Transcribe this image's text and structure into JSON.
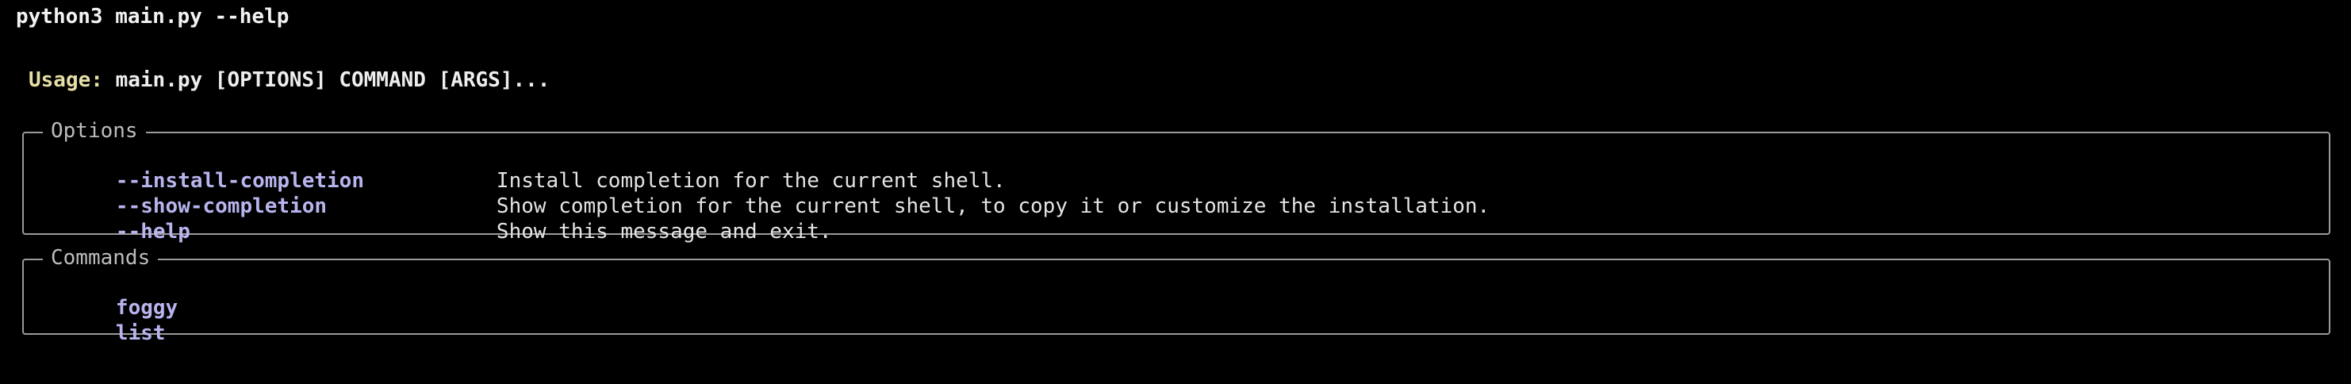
{
  "terminal": {
    "command_line": "python3 main.py --help"
  },
  "usage": {
    "label": "Usage:",
    "text": "main.py [OPTIONS] COMMAND [ARGS]..."
  },
  "options": {
    "title": "Options",
    "items": [
      {
        "name": "--install-completion",
        "description": "Install completion for the current shell."
      },
      {
        "name": "--show-completion",
        "description": "Show completion for the current shell, to copy it or customize the installation."
      },
      {
        "name": "--help",
        "description": "Show this message and exit."
      }
    ]
  },
  "commands": {
    "title": "Commands",
    "items": [
      {
        "name": "foggy"
      },
      {
        "name": "list"
      }
    ]
  },
  "colors": {
    "background": "#000000",
    "usage_label": "#e6dfa6",
    "option_name": "#b7b4ee",
    "border": "#9a9a9a"
  }
}
